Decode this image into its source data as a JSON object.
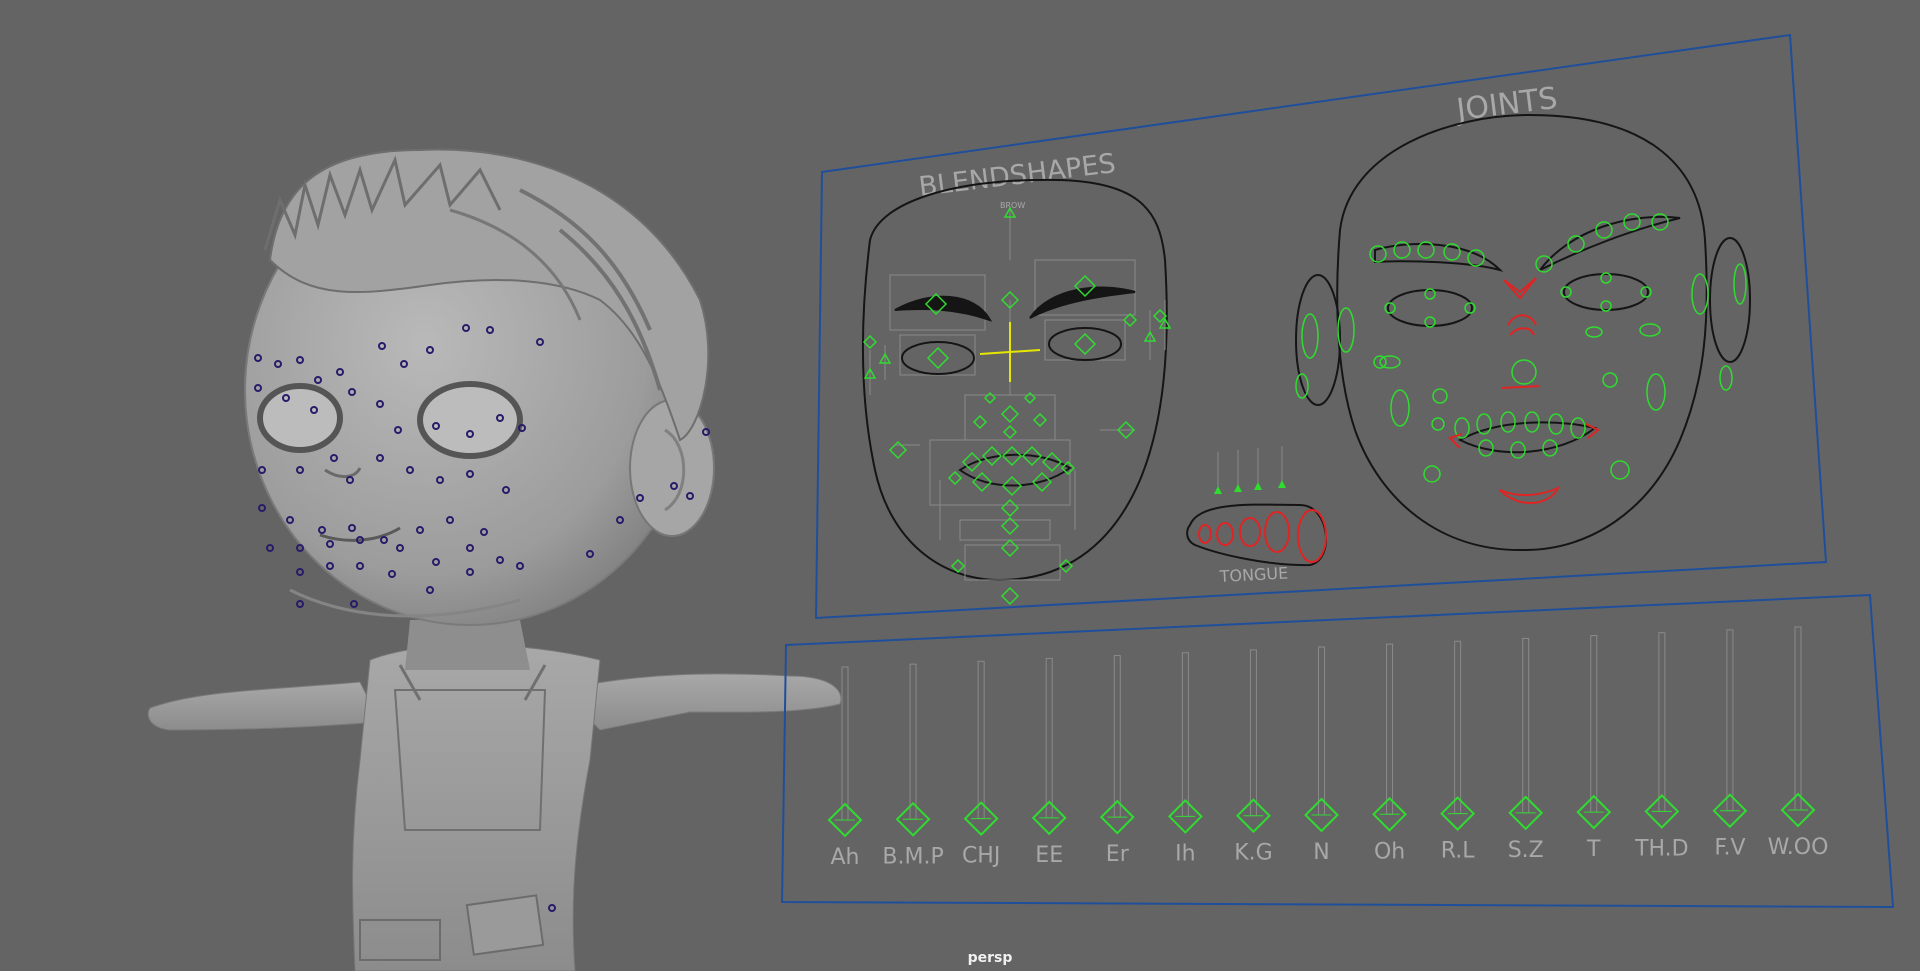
{
  "viewport": {
    "camera_label": "persp",
    "background_color": "#646464"
  },
  "colors": {
    "panel_border": "#1f4f9a",
    "control_green": "#2fdc2f",
    "control_red": "#e02424",
    "guide_black": "#151515",
    "guide_grey": "#8a8a8a",
    "label_grey": "#a8a8a8",
    "locator_purple": "#2a1a6a",
    "center_yellow": "#e6e600"
  },
  "face_panel": {
    "blendshapes_label": "BLENDSHAPES",
    "joints_label": "JOINTS",
    "tongue_label": "TONGUE",
    "small_label": "BROW"
  },
  "phoneme_panel": {
    "sliders": [
      {
        "label": "Ah",
        "value": 0
      },
      {
        "label": "B.M.P",
        "value": 0
      },
      {
        "label": "CHJ",
        "value": 0
      },
      {
        "label": "EE",
        "value": 0
      },
      {
        "label": "Er",
        "value": 0
      },
      {
        "label": "Ih",
        "value": 0
      },
      {
        "label": "K.G",
        "value": 0
      },
      {
        "label": "N",
        "value": 0
      },
      {
        "label": "Oh",
        "value": 0
      },
      {
        "label": "R.L",
        "value": 0
      },
      {
        "label": "S.Z",
        "value": 0
      },
      {
        "label": "T",
        "value": 0
      },
      {
        "label": "TH.D",
        "value": 0
      },
      {
        "label": "F.V",
        "value": 0
      },
      {
        "label": "W.OO",
        "value": 0
      }
    ]
  }
}
